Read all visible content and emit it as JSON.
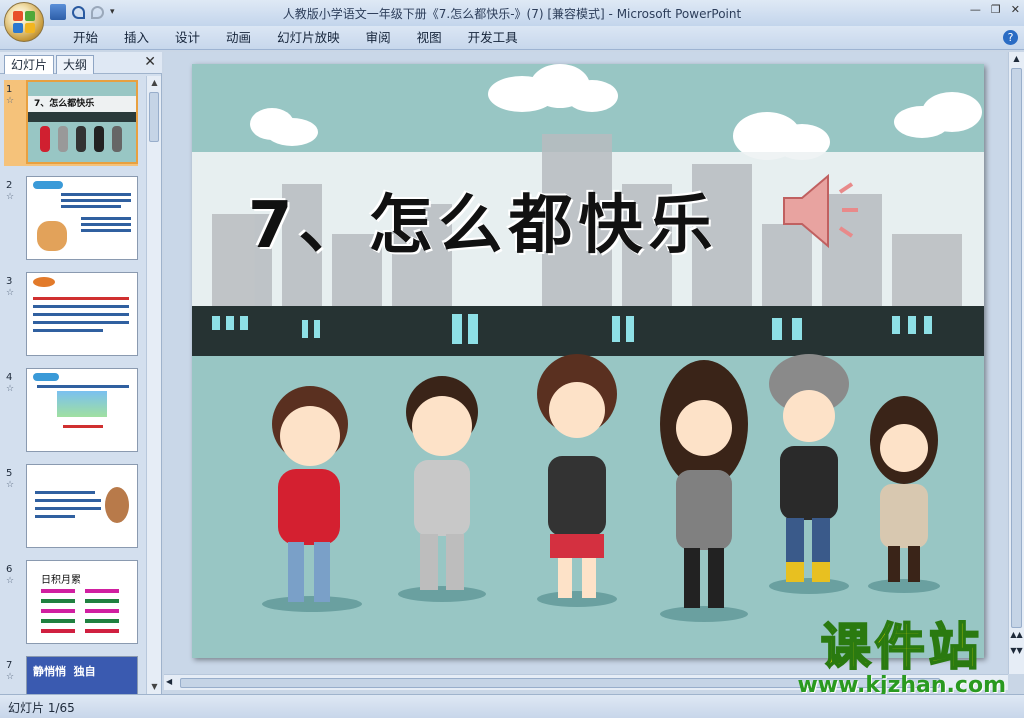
{
  "window": {
    "title": "人教版小学语文一年级下册《7.怎么都快乐-》(7) [兼容模式] - Microsoft PowerPoint"
  },
  "ribbon": {
    "tabs": [
      "开始",
      "插入",
      "设计",
      "动画",
      "幻灯片放映",
      "审阅",
      "视图",
      "开发工具"
    ]
  },
  "pane": {
    "tab_slides": "幻灯片",
    "tab_outline": "大纲"
  },
  "thumbnails": [
    {
      "num": "1",
      "star": "☆",
      "text": "7、怎么都快乐"
    },
    {
      "num": "2",
      "star": "☆",
      "text": ""
    },
    {
      "num": "3",
      "star": "☆",
      "text": ""
    },
    {
      "num": "4",
      "star": "☆",
      "text": ""
    },
    {
      "num": "5",
      "star": "☆",
      "text": ""
    },
    {
      "num": "6",
      "star": "☆",
      "text": "日积月累"
    },
    {
      "num": "7",
      "star": "☆",
      "text": "静悄悄  独自"
    }
  ],
  "slide": {
    "title": "7、怎么都快乐"
  },
  "status": {
    "slide_counter": "幻灯片 1/65"
  },
  "watermark": {
    "cn": "课件站",
    "url": "www.kjzhan.com"
  }
}
